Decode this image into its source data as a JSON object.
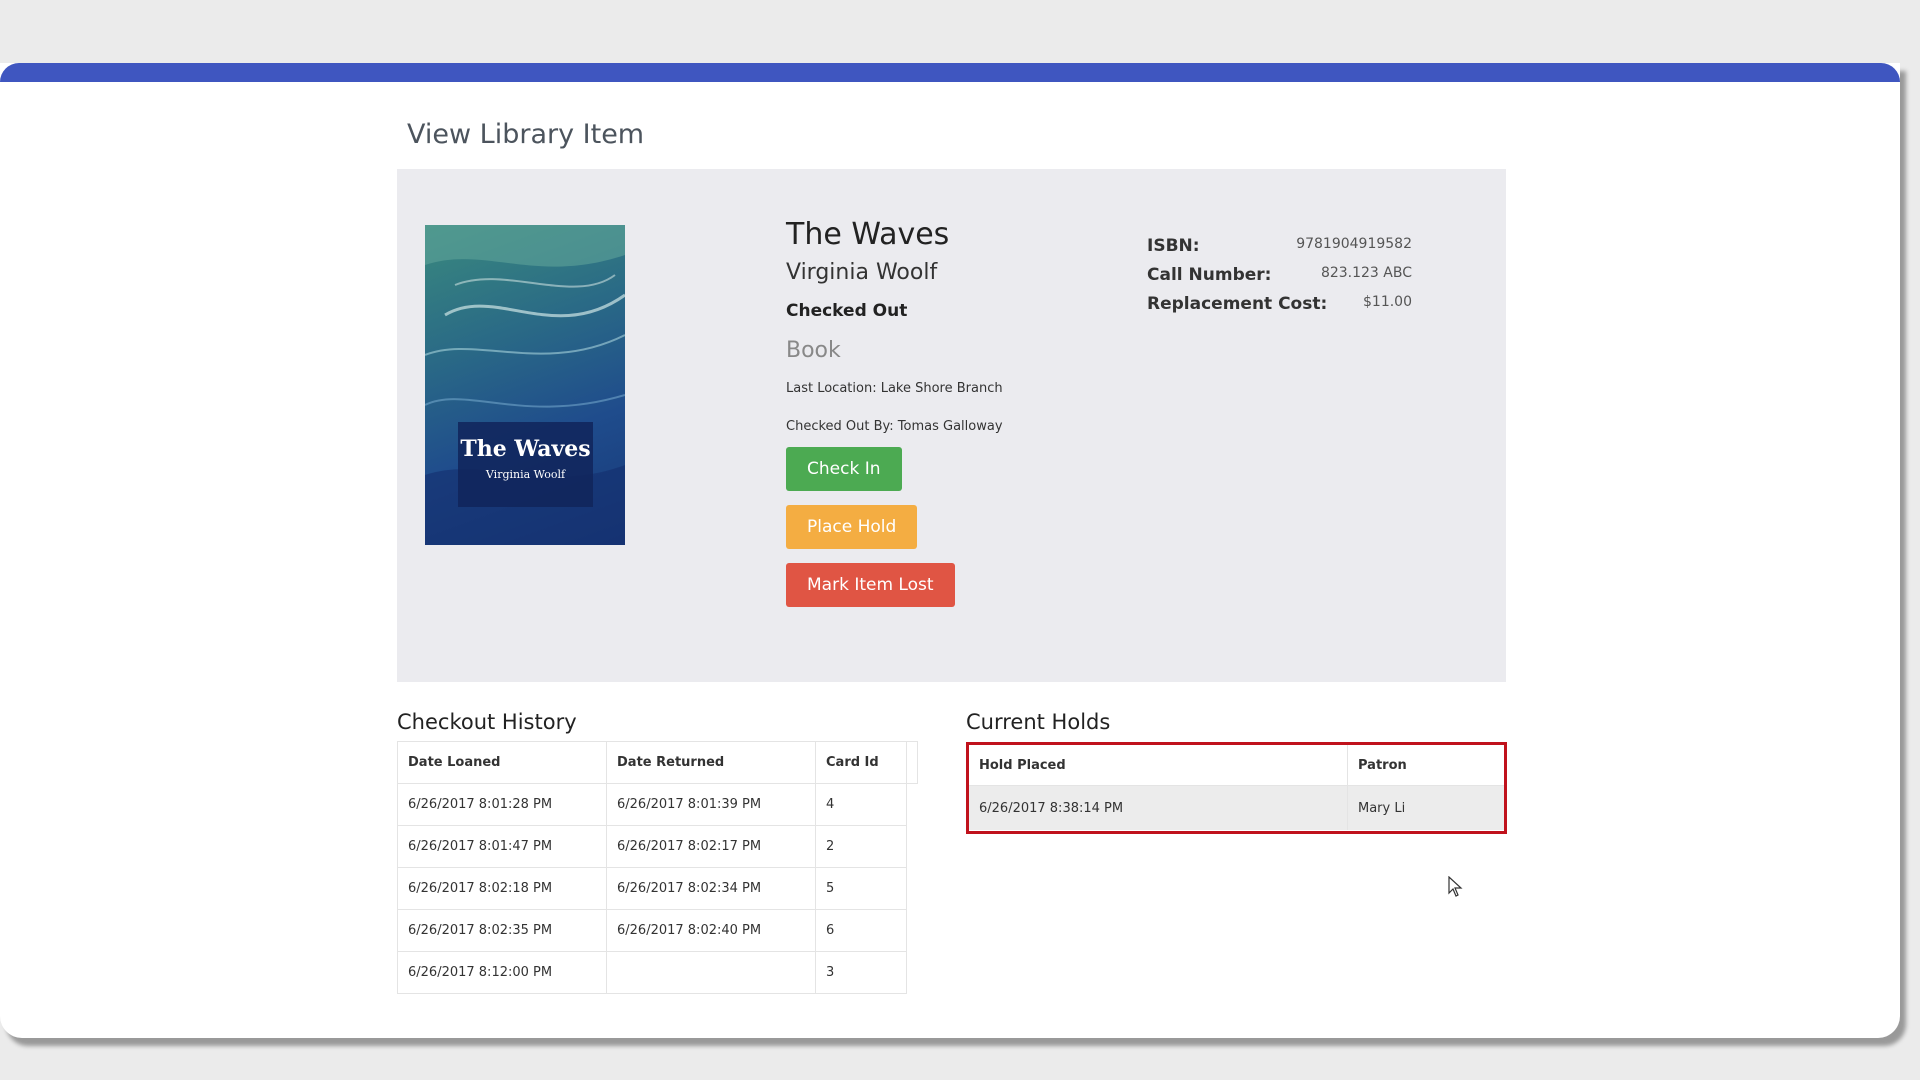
{
  "page": {
    "title": "View Library Item"
  },
  "item": {
    "cover_title": "The Waves",
    "cover_author": "Virginia Woolf",
    "title": "The Waves",
    "author": "Virginia Woolf",
    "status": "Checked Out",
    "type": "Book",
    "last_location": "Last Location: Lake Shore Branch",
    "checked_out_by": "Checked Out By: Tomas Galloway"
  },
  "actions": {
    "check_in": "Check In",
    "place_hold": "Place Hold",
    "mark_lost": "Mark Item Lost"
  },
  "meta": [
    {
      "label": "ISBN:",
      "value": "9781904919582"
    },
    {
      "label": "Call Number:",
      "value": "823.123 ABC"
    },
    {
      "label": "Replacement Cost:",
      "value": "$11.00"
    }
  ],
  "checkout_history": {
    "title": "Checkout History",
    "columns": [
      "Date Loaned",
      "Date Returned",
      "Card Id"
    ],
    "rows": [
      [
        "6/26/2017 8:01:28 PM",
        "6/26/2017 8:01:39 PM",
        "4"
      ],
      [
        "6/26/2017 8:01:47 PM",
        "6/26/2017 8:02:17 PM",
        "2"
      ],
      [
        "6/26/2017 8:02:18 PM",
        "6/26/2017 8:02:34 PM",
        "5"
      ],
      [
        "6/26/2017 8:02:35 PM",
        "6/26/2017 8:02:40 PM",
        "6"
      ],
      [
        "6/26/2017 8:12:00 PM",
        "",
        "3"
      ]
    ]
  },
  "current_holds": {
    "title": "Current Holds",
    "columns": [
      "Hold Placed",
      "Patron"
    ],
    "rows": [
      [
        "6/26/2017 8:38:14 PM",
        "Mary Li"
      ]
    ]
  },
  "colors": {
    "topbar": "#3f56c0",
    "check_in": "#4caa52",
    "place_hold": "#f4ad42",
    "mark_lost": "#e05544",
    "highlight": "#c0121c"
  }
}
